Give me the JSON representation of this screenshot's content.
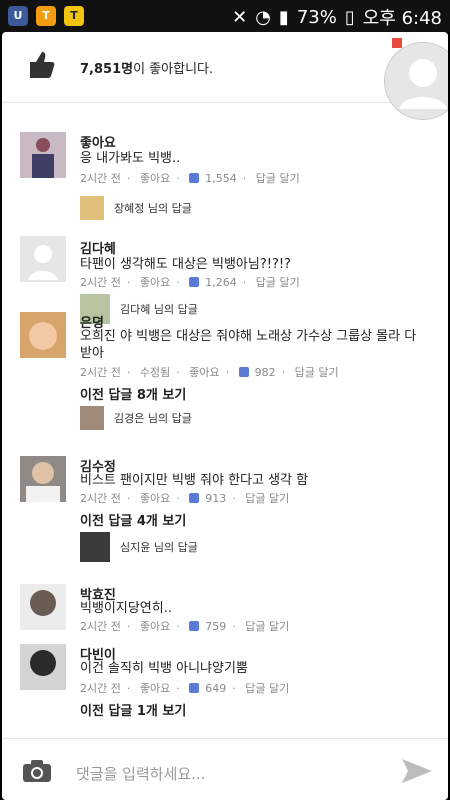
{
  "status": {
    "battery": "73%",
    "time": "오후 6:48"
  },
  "likes": {
    "count": "7,851명",
    "suffix": "이 좋아합니다."
  },
  "comments": [
    {
      "name": "좋아요",
      "text": "응 내가봐도 빅뱅..",
      "time": "2시간 전",
      "like_label": "좋아요",
      "like_count": "1,554",
      "reply_label": "답글 달기",
      "reply_preview": "장혜정 님의 답글"
    },
    {
      "name": "김다혜",
      "text": "타팬이 생각해도 대상은 빅뱅아님?!?!?",
      "time": "2시간 전",
      "like_label": "좋아요",
      "like_count": "1,264",
      "reply_label": "답글 달기",
      "reply_preview": "김다혜 님의 답글"
    },
    {
      "name": "은뎡",
      "text": "오희진 야 빅뱅은 대상은 줘야해 노래상 가수상 그룹상 몰라 다 받아",
      "time": "2시간 전",
      "edited": "수정됨",
      "like_label": "좋아요",
      "like_count": "982",
      "reply_label": "답글 달기",
      "more": "이전 답글 8개 보기",
      "reply_preview": "김경은 님의 답글"
    },
    {
      "name": "김수정",
      "text": "비스트 팬이지만 빅뱅 줘야 한다고 생각 함",
      "time": "2시간 전",
      "like_label": "좋아요",
      "like_count": "913",
      "reply_label": "답글 달기",
      "more": "이전 답글 4개 보기",
      "reply_preview": "심지윤 님의 답글"
    },
    {
      "name": "박효진",
      "text": "빅뱅이지당연히..",
      "time": "2시간 전",
      "like_label": "좋아요",
      "like_count": "759",
      "reply_label": "답글 달기"
    },
    {
      "name": "다빈이",
      "text": "이건 솔직히 빅뱅 아니냐양기뿜",
      "time": "2시간 전",
      "like_label": "좋아요",
      "like_count": "649",
      "reply_label": "답글 달기",
      "more": "이전 답글 1개 보기"
    }
  ],
  "input": {
    "placeholder": "댓글을 입력하세요..."
  },
  "colors": {
    "like_blue": "#5b7bd5",
    "status_bg": "#111111"
  }
}
